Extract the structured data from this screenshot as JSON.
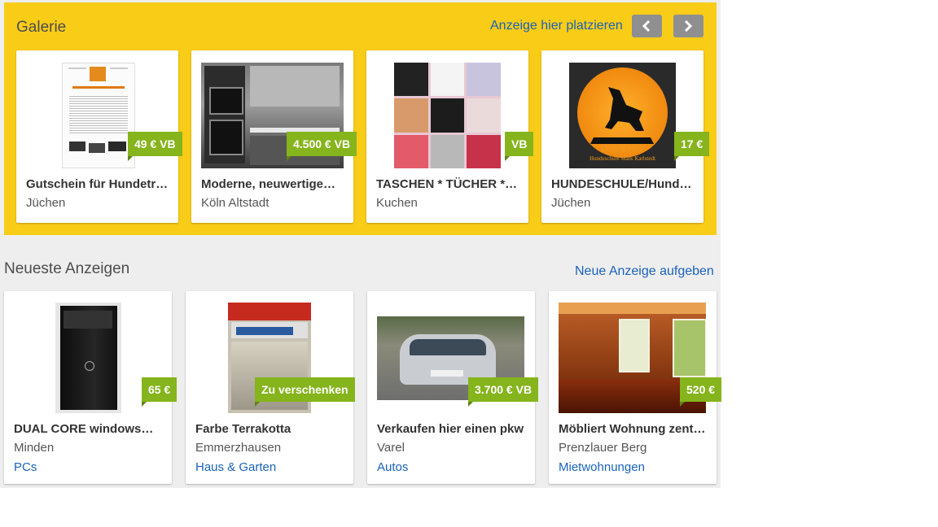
{
  "gallery": {
    "title": "Galerie",
    "place_ad_link": "Anzeige hier platzieren",
    "prev_icon": "chevron-left-icon",
    "next_icon": "chevron-right-icon",
    "items": [
      {
        "title": "Gutschein für Hundetr…",
        "location": "Jüchen",
        "price": "49 € VB"
      },
      {
        "title": "Moderne, neuwertige…",
        "location": "Köln Altstadt",
        "price": "4.500 € VB"
      },
      {
        "title": "TASCHEN * TÜCHER *…",
        "location": "Kuchen",
        "price": "VB"
      },
      {
        "title": "HUNDESCHULE/Hund…",
        "location": "Jüchen",
        "price": "17 €",
        "image_text_1": "Dog-Event",
        "image_text_2": "Hundeschule Mark Karlstedt"
      }
    ]
  },
  "newest": {
    "title": "Neueste Anzeigen",
    "post_ad_link": "Neue Anzeige aufgeben",
    "items": [
      {
        "title": "DUAL CORE windows…",
        "location": "Minden",
        "category": "PCs",
        "price": "65 €"
      },
      {
        "title": "Farbe Terrakotta",
        "location": "Emmerzhausen",
        "category": "Haus & Garten",
        "price": "Zu verschenken"
      },
      {
        "title": "Verkaufen hier einen pkw",
        "location": "Varel",
        "category": "Autos",
        "price": "3.700 € VB"
      },
      {
        "title": "Möbliert Wohnung zent…",
        "location": "Prenzlauer Berg",
        "category": "Mietwohnungen",
        "price": "520 €"
      }
    ]
  },
  "colors": {
    "gallery_bg": "#f9cc18",
    "price_badge": "#85b41c",
    "link": "#1a62b9",
    "page_bg": "#eeeeee"
  }
}
